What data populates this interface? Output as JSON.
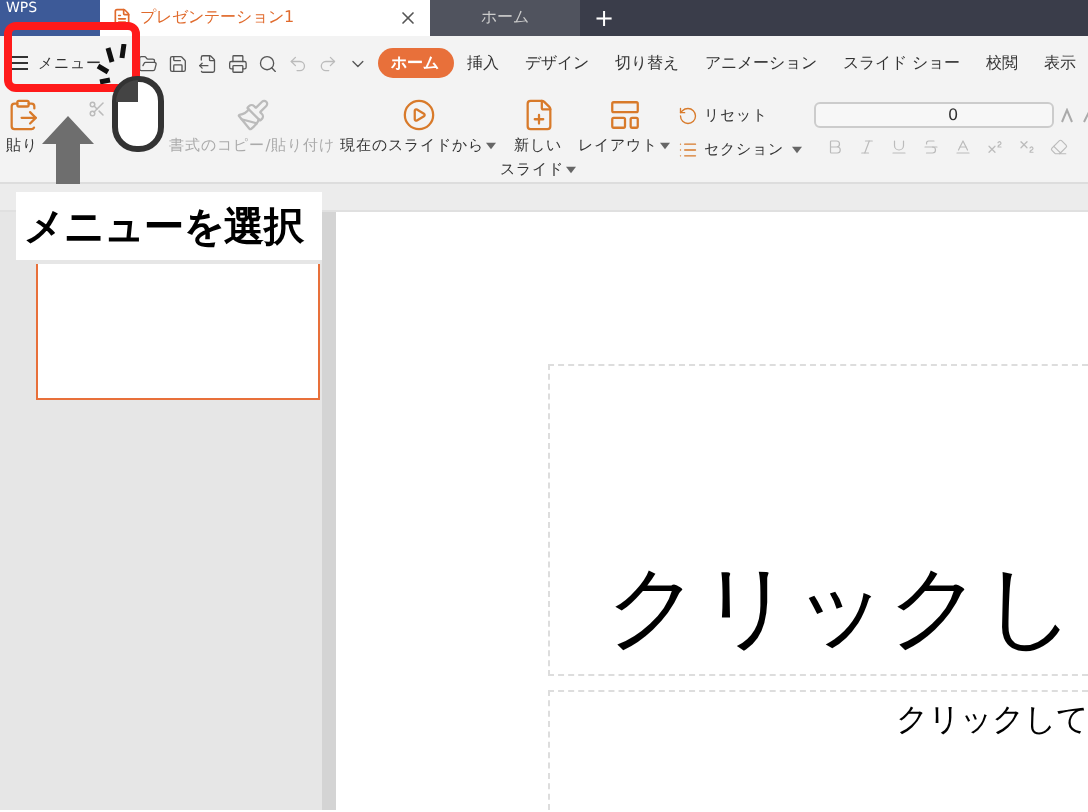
{
  "tab_bar": {
    "app_tab": "WPS",
    "tabs": [
      {
        "label": "プレゼンテーション1",
        "selected": true
      },
      {
        "label": "ホーム",
        "selected": false
      }
    ],
    "new_tab": "+"
  },
  "toolbar": {
    "menu": "メニュー"
  },
  "ribbon_tabs": [
    {
      "label": "ホーム",
      "selected": true
    },
    {
      "label": "挿入",
      "selected": false
    },
    {
      "label": "デザイン",
      "selected": false
    },
    {
      "label": "切り替え",
      "selected": false
    },
    {
      "label": "アニメーション",
      "selected": false
    },
    {
      "label": "スライド ショー",
      "selected": false
    },
    {
      "label": "校閲",
      "selected": false
    },
    {
      "label": "表示",
      "selected": false
    }
  ],
  "ribbon": {
    "buttons": [
      {
        "kind": "large",
        "label": "貼り",
        "disabled": false,
        "dropdown": false
      },
      {
        "kind": "large",
        "label": "書式のコピー/貼り付け",
        "disabled": true,
        "dropdown": false
      },
      {
        "kind": "large",
        "label": "現在のスライドから",
        "disabled": false,
        "dropdown": true
      },
      {
        "kind": "large",
        "lines": [
          "新しい",
          "スライド"
        ],
        "disabled": false,
        "dropdown": true
      },
      {
        "kind": "large",
        "label": "レイアウト",
        "disabled": false,
        "dropdown": true
      },
      {
        "kind": "stack",
        "label": "リセット",
        "label_2": "セクション",
        "disabled": false,
        "dropdown": true
      }
    ],
    "font_size": "0"
  },
  "slide": {
    "title": "クリックし",
    "subtitle": "クリックして"
  },
  "annotation": {
    "label": "メニューを選択"
  }
}
